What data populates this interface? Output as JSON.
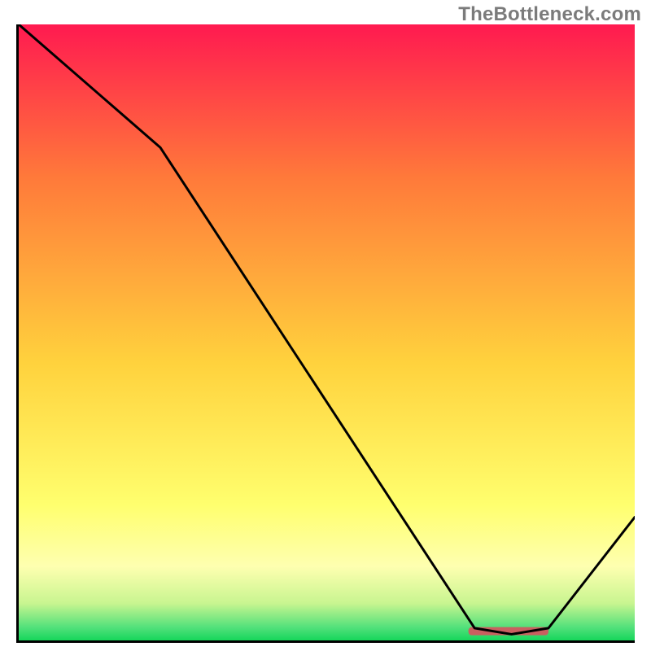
{
  "watermark": "TheBottleneck.com",
  "chart_data": {
    "type": "line",
    "title": "",
    "xlabel": "",
    "ylabel": "",
    "xlim": [
      0,
      100
    ],
    "ylim": [
      0,
      100
    ],
    "grid": false,
    "legend": false,
    "x": [
      0,
      23,
      74,
      80,
      86,
      100
    ],
    "values": [
      100,
      80,
      2,
      1,
      2,
      20
    ],
    "series": [
      {
        "name": "curve",
        "x": [
          0,
          23,
          74,
          80,
          86,
          100
        ],
        "values": [
          100,
          80,
          2,
          1,
          2,
          20
        ],
        "color": "#000000"
      }
    ],
    "marker_segment": {
      "x0": 73,
      "x1": 86,
      "y": 1.5,
      "color": "#c96060"
    },
    "gradient_stops": [
      {
        "offset": 0,
        "color": "#ff1a50"
      },
      {
        "offset": 0.25,
        "color": "#ff7a3a"
      },
      {
        "offset": 0.55,
        "color": "#ffd23d"
      },
      {
        "offset": 0.78,
        "color": "#ffff6e"
      },
      {
        "offset": 0.88,
        "color": "#feffb0"
      },
      {
        "offset": 0.94,
        "color": "#c8f590"
      },
      {
        "offset": 0.98,
        "color": "#4fe07a"
      },
      {
        "offset": 1.0,
        "color": "#16d65a"
      }
    ]
  }
}
